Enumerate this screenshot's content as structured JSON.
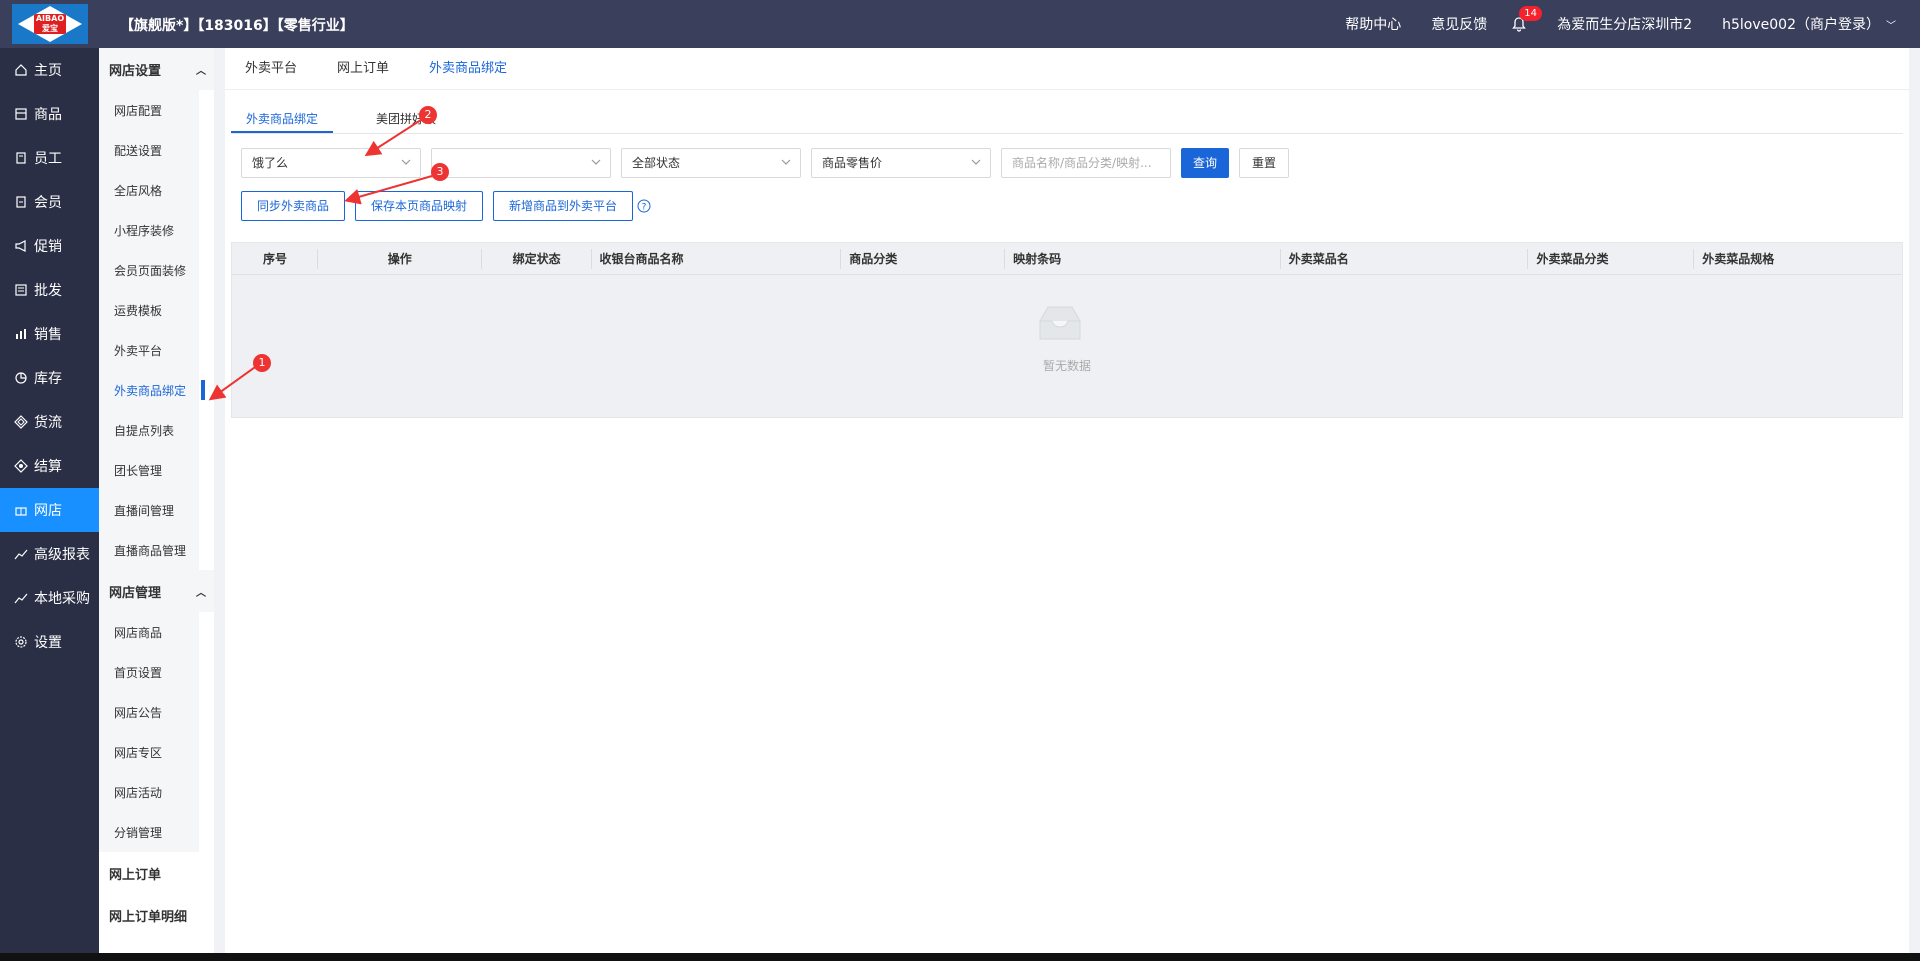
{
  "header": {
    "logo_text": "AIBAO 爱宝",
    "shop_title": "【旗舰版*】【183016】【零售行业】",
    "help_center": "帮助中心",
    "feedback": "意见反馈",
    "notify_count": "14",
    "store": "為爱而生分店深圳市2",
    "user": "h5love002（商户登录）"
  },
  "leftnav": [
    {
      "label": "主页",
      "icon": "home-icon"
    },
    {
      "label": "商品",
      "icon": "goods-icon"
    },
    {
      "label": "员工",
      "icon": "staff-icon"
    },
    {
      "label": "会员",
      "icon": "member-icon"
    },
    {
      "label": "促销",
      "icon": "promo-icon"
    },
    {
      "label": "批发",
      "icon": "wholesale-icon"
    },
    {
      "label": "销售",
      "icon": "sales-icon"
    },
    {
      "label": "库存",
      "icon": "stock-icon"
    },
    {
      "label": "货流",
      "icon": "flow-icon"
    },
    {
      "label": "结算",
      "icon": "settle-icon"
    },
    {
      "label": "网店",
      "icon": "gift-icon"
    },
    {
      "label": "高级报表",
      "icon": "chart-icon"
    },
    {
      "label": "本地采购",
      "icon": "chart-icon"
    },
    {
      "label": "设置",
      "icon": "gear-icon"
    }
  ],
  "subnav": {
    "group1_title": "网店设置",
    "group1_items": [
      "网店配置",
      "配送设置",
      "全店风格",
      "小程序装修",
      "会员页面装修",
      "运费模板",
      "外卖平台",
      "外卖商品绑定",
      "自提点列表",
      "团长管理",
      "直播间管理",
      "直播商品管理"
    ],
    "group2_title": "网店管理",
    "group2_items": [
      "网店商品",
      "首页设置",
      "网店公告",
      "网店专区",
      "网店活动",
      "分销管理"
    ],
    "plain_items": [
      "网上订单",
      "网上订单明细"
    ]
  },
  "tabs1": [
    "外卖平台",
    "网上订单",
    "外卖商品绑定"
  ],
  "tabs2": [
    "外卖商品绑定",
    "美团拼好饭"
  ],
  "filters": {
    "platform": "饿了么",
    "store_select": "",
    "status": "全部状态",
    "price": "商品零售价",
    "search_placeholder": "商品名称/商品分类/映射...",
    "query": "查询",
    "reset": "重置"
  },
  "actions": {
    "sync": "同步外卖商品",
    "save": "保存本页商品映射",
    "add": "新增商品到外卖平台"
  },
  "table": {
    "columns": [
      "序号",
      "操作",
      "绑定状态",
      "收银台商品名称",
      "商品分类",
      "映射条码",
      "外卖菜品名",
      "外卖菜品分类",
      "外卖菜品规格"
    ],
    "empty_text": "暂无数据"
  },
  "annotations": [
    "1",
    "2",
    "3"
  ],
  "colors": {
    "accent": "#1a66d9",
    "topbar": "#3a3f5c",
    "nav": "#2b2f45",
    "nav_active": "#1890ff",
    "marker": "#e33333"
  }
}
